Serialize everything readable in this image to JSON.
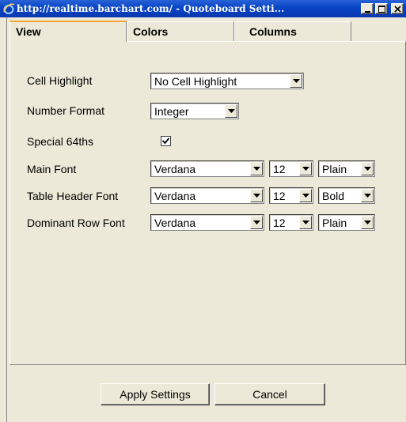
{
  "window": {
    "title": "http://realtime.barchart.com/ - Quoteboard Setti...",
    "controls": [
      "minimize-icon",
      "maximize-icon",
      "close-icon"
    ]
  },
  "tabs": [
    {
      "label": "View",
      "active": true
    },
    {
      "label": "Colors",
      "active": false
    },
    {
      "label": "Columns",
      "active": false
    }
  ],
  "settings": {
    "cell_highlight": {
      "label": "Cell Highlight",
      "value": "No Cell Highlight"
    },
    "number_format": {
      "label": "Number Format",
      "value": "Integer"
    },
    "special_64ths": {
      "label": "Special 64ths",
      "checked": true
    },
    "main_font": {
      "label": "Main Font",
      "family": "Verdana",
      "size": "12",
      "style": "Plain"
    },
    "table_header_font": {
      "label": "Table Header Font",
      "family": "Verdana",
      "size": "12",
      "style": "Bold"
    },
    "dominant_row_font": {
      "label": "Dominant Row Font",
      "family": "Verdana",
      "size": "12",
      "style": "Plain"
    }
  },
  "buttons": {
    "apply": "Apply Settings",
    "cancel": "Cancel"
  },
  "colors": {
    "titlebar": "#0a46c8",
    "window_bg": "#ece9d8",
    "active_tab_accent": "#f2a536"
  }
}
